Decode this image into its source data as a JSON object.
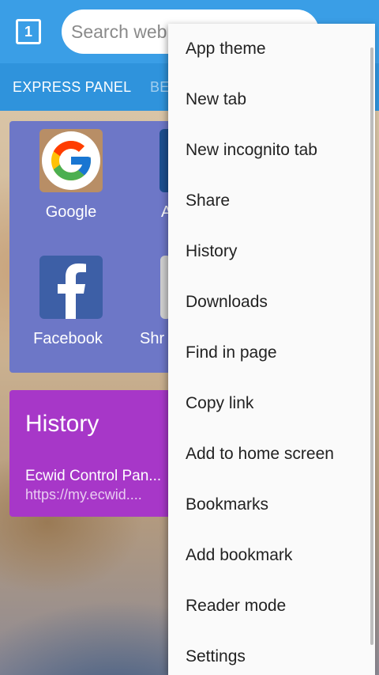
{
  "toolbar": {
    "tab_count": "1",
    "search_placeholder": "Search web"
  },
  "tabs": [
    {
      "label": "EXPRESS PANEL"
    },
    {
      "label": "BE"
    }
  ],
  "express_panel": {
    "tiles": [
      {
        "label": "Google",
        "icon": "google-icon"
      },
      {
        "label": "A",
        "icon": "partial-app-icon"
      },
      {
        "label": "Facebook",
        "icon": "facebook-icon"
      },
      {
        "label": "Shr",
        "icon": "partial-app-icon"
      }
    ]
  },
  "history_card": {
    "title": "History",
    "item_title": "Ecwid Control Pan...",
    "item_url": "https://my.ecwid...."
  },
  "menu": {
    "items": [
      {
        "label": "App theme"
      },
      {
        "label": "New tab"
      },
      {
        "label": "New incognito tab"
      },
      {
        "label": "Share"
      },
      {
        "label": "History"
      },
      {
        "label": "Downloads"
      },
      {
        "label": "Find in page"
      },
      {
        "label": "Copy link"
      },
      {
        "label": "Add to home screen"
      },
      {
        "label": "Bookmarks"
      },
      {
        "label": "Add bookmark"
      },
      {
        "label": "Reader mode"
      },
      {
        "label": "Settings"
      }
    ]
  },
  "colors": {
    "toolbar": "#3a9ee6",
    "tabs_bar": "#2f93dc",
    "express_card": "#6d77c7",
    "history_card": "#a737c8",
    "menu_bg": "#fafafa"
  }
}
